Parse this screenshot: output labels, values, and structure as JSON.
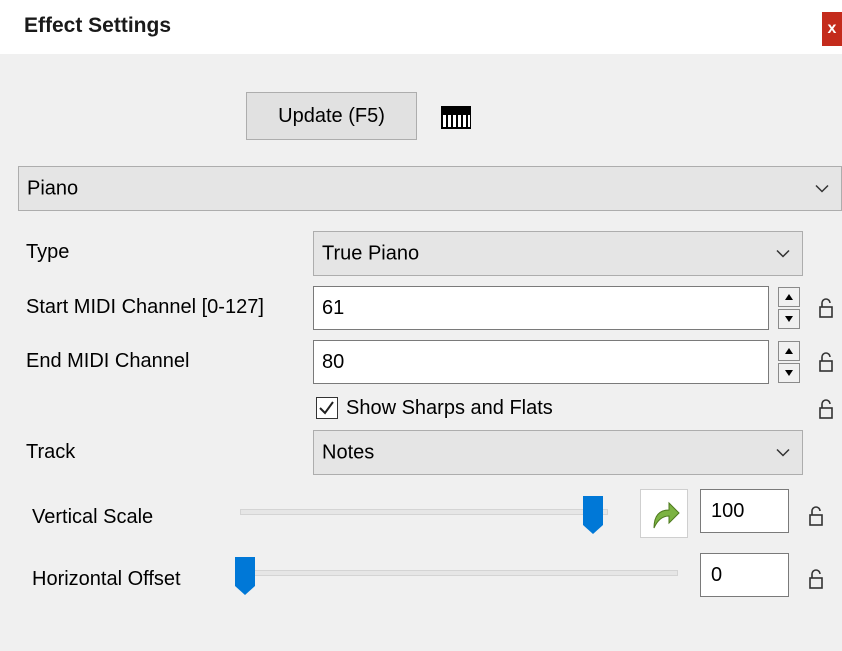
{
  "window": {
    "title": "Effect Settings",
    "close_label": "x"
  },
  "toolbar": {
    "update_label": "Update (F5)",
    "icon": "piano-icon"
  },
  "effect": {
    "selected": "Piano"
  },
  "fields": {
    "type_label": "Type",
    "type_value": "True Piano",
    "start_label": "Start MIDI Channel [0-127]",
    "start_value": "61",
    "end_label": "End MIDI Channel",
    "end_value": "80",
    "sharps_label": "Show Sharps and Flats",
    "sharps_checked": true,
    "track_label": "Track",
    "track_value": "Notes"
  },
  "sliders": {
    "vertical_scale_label": "Vertical Scale",
    "vertical_scale_value": "100",
    "vertical_scale_level": 1.0,
    "horizontal_offset_label": "Horizontal Offset",
    "horizontal_offset_value": "0",
    "horizontal_offset_level": 0.0
  },
  "colors": {
    "close": "#c42b1c",
    "slider_thumb": "#0078d7",
    "reset_arrow": "#7cb342"
  }
}
